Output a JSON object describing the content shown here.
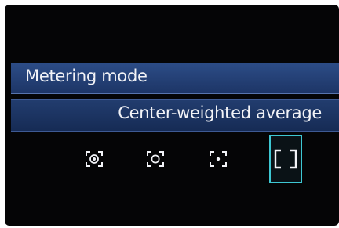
{
  "menu": {
    "title": "Metering mode",
    "selected_value": "Center-weighted average"
  },
  "modes": [
    {
      "icon": "evaluative-metering-icon",
      "label": "Evaluative metering",
      "selected": false
    },
    {
      "icon": "partial-metering-icon",
      "label": "Partial metering",
      "selected": false
    },
    {
      "icon": "spot-metering-icon",
      "label": "Spot metering",
      "selected": false
    },
    {
      "icon": "center-weighted-average-icon",
      "label": "Center-weighted average",
      "selected": true
    }
  ],
  "colors": {
    "title_bar": "#2c4c86",
    "value_bar": "#223d6f",
    "selection": "#3ec7d2",
    "text": "#f2f3f7"
  }
}
